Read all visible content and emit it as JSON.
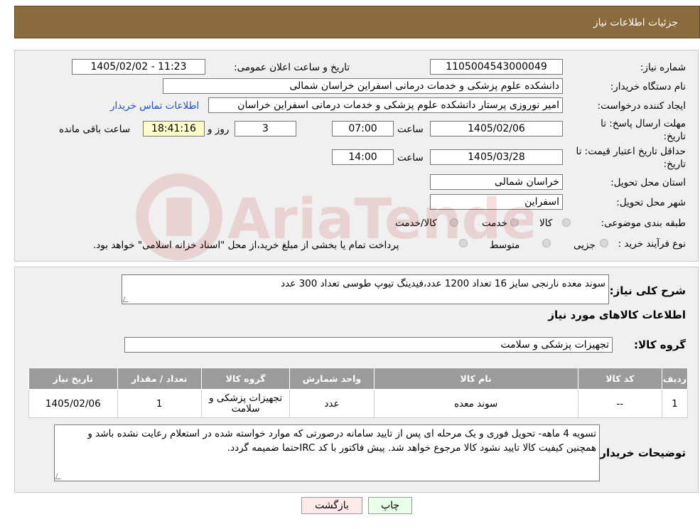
{
  "header": {
    "title": "جزئیات اطلاعات نیاز"
  },
  "fields": {
    "need_number_label": "شماره نیاز:",
    "need_number": "1105004543000049",
    "announce_label": "تاریخ و ساعت اعلان عمومی:",
    "announce_value": "1405/02/02 - 11:23",
    "buyer_org_label": "نام دستگاه خریدار:",
    "buyer_org": "دانشکده علوم پزشکی و خدمات درمانی اسفراین خراسان شمالی",
    "requester_label": "ایجاد کننده درخواست:",
    "requester": "امیر  نوروزی  پرستار  دانشکده علوم پزشکی و خدمات درمانی اسفراین خراسان",
    "contact_link": "اطلاعات تماس خریدار",
    "deadline_label": "مهلت ارسال پاسخ: تا تاریخ:",
    "deadline_date": "1405/02/06",
    "time_label": "ساعت",
    "deadline_time": "07:00",
    "days": "3",
    "days_label": "روز و",
    "remaining": "18:41:16",
    "remaining_label": "ساعت باقی مانده",
    "validity_label": "حداقل تاریخ اعتبار قیمت: تا تاریخ:",
    "validity_date": "1405/03/28",
    "validity_time": "14:00",
    "province_label": "استان محل تحویل:",
    "province": "خراسان شمالی",
    "city_label": "شهر محل تحویل:",
    "city": "اسفراین",
    "category_label": "طبقه بندی موضوعی:",
    "category_options": [
      "کالا",
      "خدمت",
      "کالا/خدمت"
    ],
    "process_label": "نوع فرآیند خرید :",
    "process_options": [
      "جزیی",
      "متوسط"
    ],
    "process_note": "پرداخت تمام یا بخشی از مبلغ خرید،از محل \"اسناد خزانه اسلامی\" خواهد بود."
  },
  "details": {
    "summary_label": "شرح کلی نیاز:",
    "summary": "سوند معده نارنجی سایز 16 تعداد 1200 عدد،فیدینگ تیوپ طوسی تعداد 300 عدد",
    "items_heading": "اطلاعات کالاهای مورد نیاز",
    "group_label": "گروه کالا:",
    "group_value": "تجهیزات پزشکی و سلامت",
    "table": {
      "headers": [
        "ردیف",
        "کد کالا",
        "نام کالا",
        "واحد شمارش",
        "گروه کالا",
        "تعداد / مقدار",
        "تاریخ نیاز"
      ],
      "rows": [
        [
          "1",
          "--",
          "سوند معده",
          "عدد",
          "تجهیزات پزشکی و سلامت",
          "1",
          "1405/02/06"
        ]
      ]
    },
    "buyer_notes_label": "توضیحات خریدار:",
    "buyer_notes": "تسویه 4 ماهه- تحویل فوری و یک مرحله ای پس از تایید سامانه درصورتی که موارد خواسته شده در استعلام رعایت نشده باشد و همچنین کیفیت کالا تایید نشود کالا مرجوع خواهد شد. پیش فاکتور با کد IRCحتما ضمیمه گردد."
  },
  "buttons": {
    "print": "چاپ",
    "back": "بازگشت"
  },
  "watermark_text": "AriaTender.neT",
  "colors": {
    "header_bg": "#8b6a3e",
    "table_header_bg": "#9b9b9b",
    "remaining_bg": "#ffffcc"
  }
}
